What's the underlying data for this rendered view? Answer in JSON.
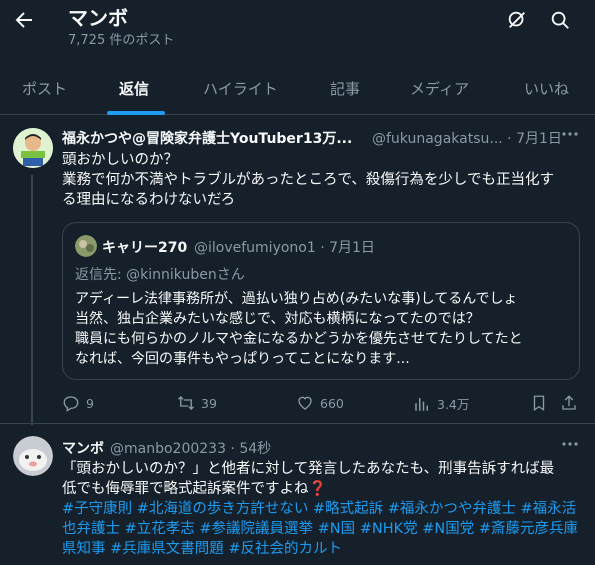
{
  "header": {
    "title": "マンボ",
    "post_count": "7,725 件のポスト"
  },
  "tabs": [
    "ポスト",
    "返信",
    "ハイライト",
    "記事",
    "メディア",
    "いいね"
  ],
  "active_tab": "返信",
  "tweet1": {
    "name": "福永かつや@冒険家弁護士YouTuber13万...",
    "handle_time": "@fukunagakatsu... · 7月1日",
    "lines": [
      "頭おかしいのか？",
      "業務で何か不満やトラブルがあったところで、殺傷行為を少しでも正当化す",
      "る理由になるわけないだろ"
    ],
    "quote": {
      "name": "キャリー270",
      "handle_time": "@ilovefumiyono1 · 7月1日",
      "reply_prefix": "返信先: ",
      "reply_handle": "@kinnikubenさん",
      "lines": [
        "アディーレ法律事務所が、過払い独り占め(みたいな事)してるんでしょ",
        "当然、独占企業みたいな感じで、対応も横柄になってたのでは？",
        "職員にも何らかのノルマや金になるかどうかを優先させてたりしてたと",
        "なれば、今回の事件もやっぱりってことになります..."
      ]
    },
    "stats": {
      "replies": "9",
      "retweets": "39",
      "likes": "660",
      "views": "3.4万"
    }
  },
  "tweet2": {
    "name": "マンボ",
    "handle_time": "@manbo200233 · 54秒",
    "line1": "「頭おかしいのか？」と他者に対して発言したあなたも、刑事告訴すれば最",
    "line2": "低でも侮辱罪で略式起訴案件ですよね❓",
    "tags": [
      "#子守康則 #北海道の歩き方許せない #略式起訴 #福永かつや弁護士 #福永活",
      "也弁護士 #立花孝志 #参議院議員選挙 #N国 #NHK党 #N国党 #斎藤元彦兵庫",
      "県知事 #兵庫県文書問題 #反社会的カルト"
    ]
  },
  "colors": {
    "background": "#15202b",
    "accent": "#1d9bf0",
    "muted": "#8b98a5"
  }
}
